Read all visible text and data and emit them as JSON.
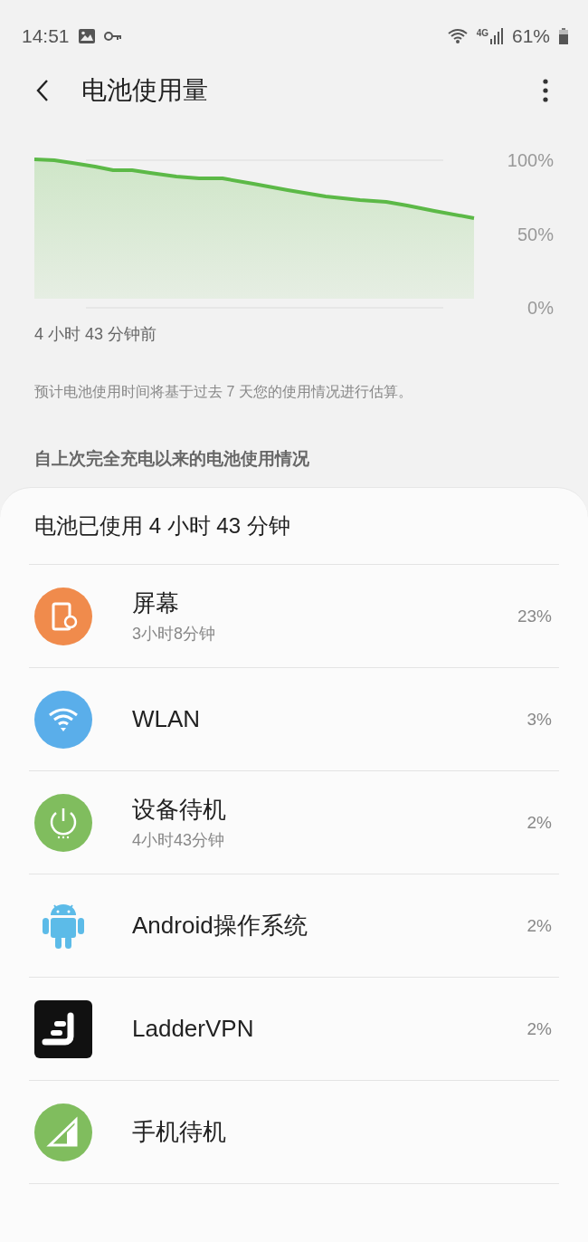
{
  "status_bar": {
    "time": "14:51",
    "network": "4G",
    "battery": "61%"
  },
  "header": {
    "title": "电池使用量"
  },
  "chart": {
    "axis_labels": [
      "100%",
      "50%",
      "0%"
    ],
    "start_label": "4 小时 43 分钟前"
  },
  "note": "预计电池使用时间将基于过去 7 天您的使用情况进行估算。",
  "section_title": "自上次完全充电以来的电池使用情况",
  "usage": {
    "total": "电池已使用 4 小时 43 分钟",
    "items": [
      {
        "kind": "screen",
        "name": "屏幕",
        "detail": "3小时8分钟",
        "percent": "23%"
      },
      {
        "kind": "wifi",
        "name": "WLAN",
        "percent": "3%"
      },
      {
        "kind": "standby",
        "name": "设备待机",
        "detail": "4小时43分钟",
        "percent": "2%"
      },
      {
        "kind": "android",
        "name": "Android操作系统",
        "percent": "2%"
      },
      {
        "kind": "app",
        "name": "LadderVPN",
        "percent": "2%"
      },
      {
        "kind": "cell",
        "name": "手机待机"
      }
    ]
  }
}
